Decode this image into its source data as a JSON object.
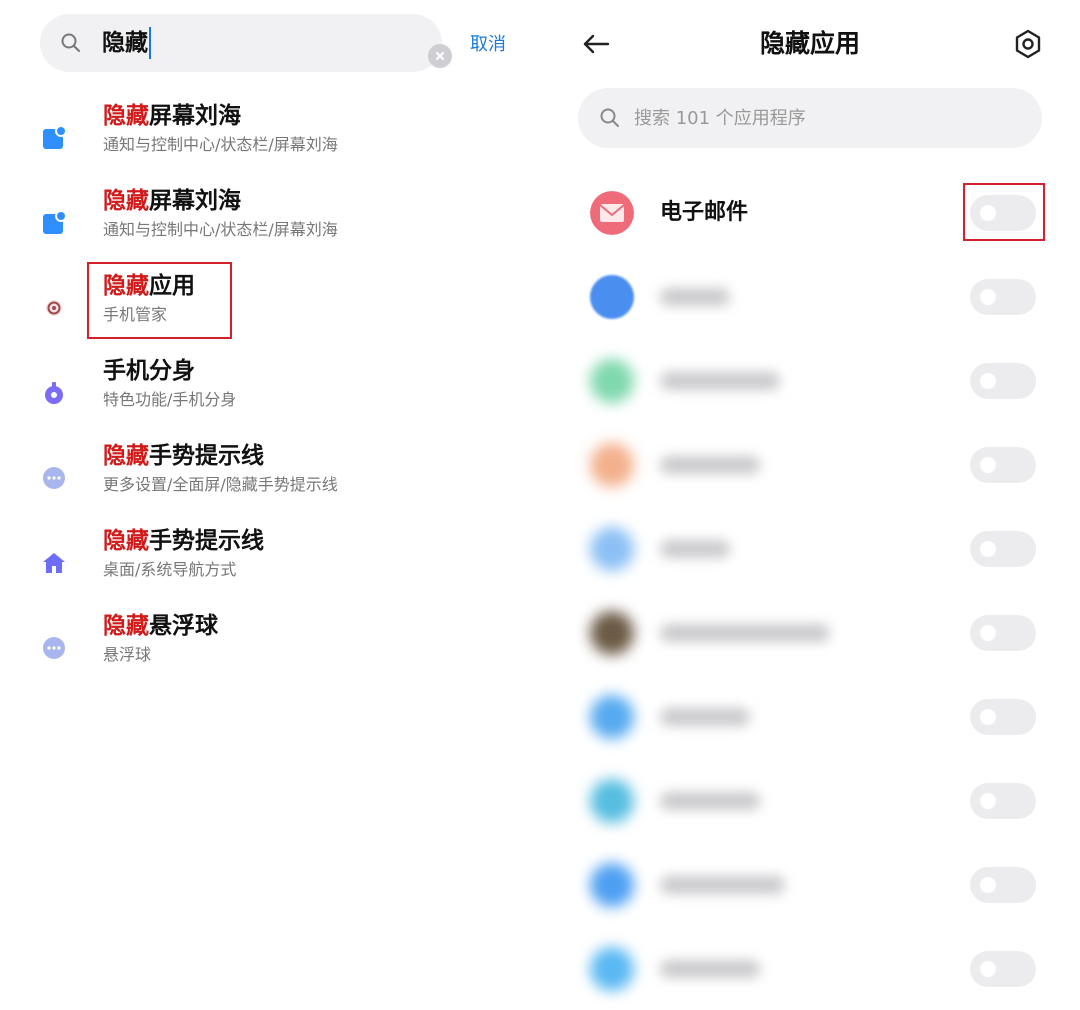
{
  "search": {
    "query": "隐藏",
    "cancel_label": "取消"
  },
  "results": [
    {
      "hl": "隐藏",
      "rest": "屏幕刘海",
      "sub": "通知与控制中心/状态栏/屏幕刘海",
      "icon": "notch-icon",
      "color": "#2f8fff"
    },
    {
      "hl": "隐藏",
      "rest": "屏幕刘海",
      "sub": "通知与控制中心/状态栏/屏幕刘海",
      "icon": "notch-icon",
      "color": "#2f8fff"
    },
    {
      "hl": "隐藏",
      "rest": "应用",
      "sub": "手机管家",
      "icon": "security-app-icon",
      "color": "#a0484f"
    },
    {
      "hl": "",
      "rest": "手机分身",
      "sub": "特色功能/手机分身",
      "icon": "second-space-icon",
      "color": "#7b6cf5"
    },
    {
      "hl": "隐藏",
      "rest": "手势提示线",
      "sub": "更多设置/全面屏/隐藏手势提示线",
      "icon": "more-settings-icon",
      "color": "#a9b6ee"
    },
    {
      "hl": "隐藏",
      "rest": "手势提示线",
      "sub": "桌面/系统导航方式",
      "icon": "home-icon",
      "color": "#6d6ef5"
    },
    {
      "hl": "隐藏",
      "rest": "悬浮球",
      "sub": "悬浮球",
      "icon": "more-settings-icon",
      "color": "#a9b6ee"
    }
  ],
  "hidden_apps": {
    "title": "隐藏应用",
    "search_placeholder": "搜索 101 个应用程序",
    "apps": [
      {
        "name": "电子邮件",
        "icon": "email-app-icon",
        "color": "#f06b7a",
        "hidden": false
      },
      {
        "name": "",
        "icon": "blurred-app-icon",
        "color": "#4a8ef0",
        "hidden": false
      },
      {
        "name": "",
        "icon": "blurred-app-icon",
        "color": "#7fd8ae",
        "hidden": false
      },
      {
        "name": "",
        "icon": "blurred-app-icon",
        "color": "#f3b08c",
        "hidden": false
      },
      {
        "name": "",
        "icon": "blurred-app-icon",
        "color": "#8cc0f5",
        "hidden": false
      },
      {
        "name": "",
        "icon": "blurred-app-icon",
        "color": "#6b5a45",
        "hidden": false
      },
      {
        "name": "",
        "icon": "blurred-app-icon",
        "color": "#56aaf0",
        "hidden": false
      },
      {
        "name": "",
        "icon": "blurred-app-icon",
        "color": "#56bde0",
        "hidden": false
      },
      {
        "name": "",
        "icon": "blurred-app-icon",
        "color": "#4d9ff2",
        "hidden": false
      },
      {
        "name": "",
        "icon": "blurred-app-icon",
        "color": "#5ab8f2",
        "hidden": false
      }
    ]
  },
  "colors": {
    "highlight_red": "#d11a1a",
    "annotation_border": "#d4202a",
    "accent_blue": "#1a7ad8"
  }
}
